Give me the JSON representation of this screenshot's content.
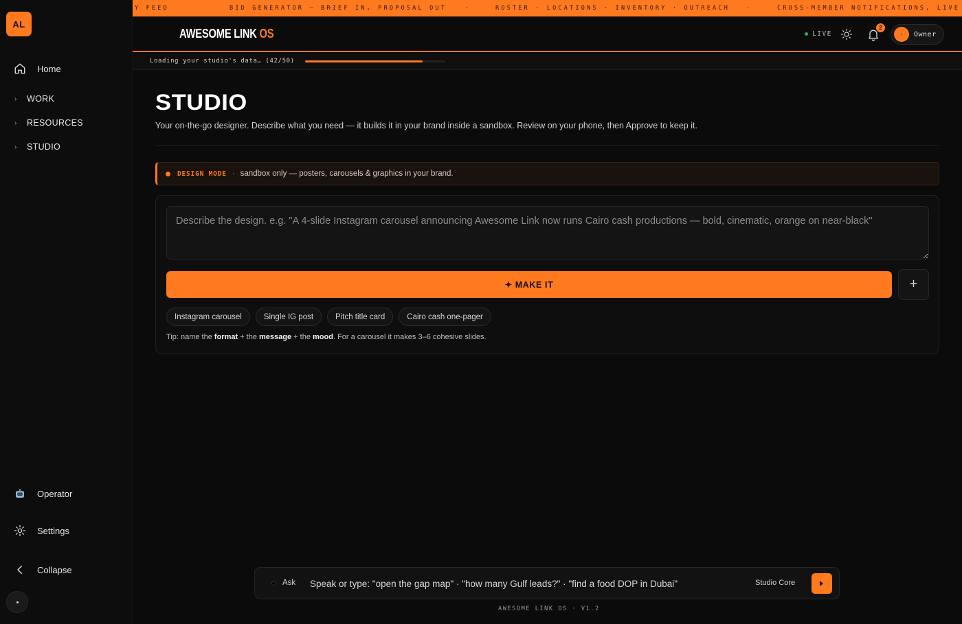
{
  "sidebar": {
    "logo": "AL",
    "home": "Home",
    "groups": [
      "WORK",
      "RESOURCES",
      "STUDIO"
    ],
    "operator": "Operator",
    "settings": "Settings",
    "collapse": "Collapse"
  },
  "ticker": {
    "items": [
      "Y FEED",
      "·",
      "BID GENERATOR — BRIEF IN, PROPOSAL OUT",
      "·",
      "ROSTER · LOCATIONS · INVENTORY · OUTREACH",
      "·",
      "CROSS-MEMBER NOTIFICATIONS, LIVE"
    ]
  },
  "topbar": {
    "brand": "AWESOME LINK",
    "brand_accent": "OS",
    "live": "LIVE",
    "notifications": "2",
    "user": "Owner",
    "avatar": "·"
  },
  "loading": {
    "text": "Loading your studio's data… (42/50)",
    "progress": 0.84
  },
  "page": {
    "title": "STUDIO",
    "subtitle": "Your on-the-go designer. Describe what you need — it builds it in your brand inside a sandbox. Review on your phone, then Approve to keep it.",
    "mode_label": "DESIGN MODE",
    "mode_sep": "·",
    "mode_text": "sandbox only — posters, carousels & graphics in your brand.",
    "prompt_placeholder": "Describe the design. e.g. \"A 4-slide Instagram carousel announcing Awesome Link now runs Cairo cash productions — bold, cinematic, orange on near-black\"",
    "make_button": "✦ MAKE IT",
    "plus": "+",
    "chips": [
      "Instagram carousel",
      "Single IG post",
      "Pitch title card",
      "Cairo cash one-pager"
    ],
    "tip": {
      "a": "Tip: name the ",
      "b": "format",
      "c": " + the ",
      "d": "message",
      "e": " + the ",
      "f": "mood",
      "g": ". For a carousel it makes 3–6 cohesive slides."
    }
  },
  "askbar": {
    "label": "Ask",
    "placeholder": "Speak or type: \"open the gap map\" · \"how many Gulf leads?\" · \"find a food DOP in Dubai\"",
    "model": "Studio Core"
  },
  "footer": "AWESOME LINK OS · V1.2",
  "colors": {
    "accent": "#ff7a1f",
    "background": "#0b0b0b",
    "live": "#3aa65a"
  }
}
